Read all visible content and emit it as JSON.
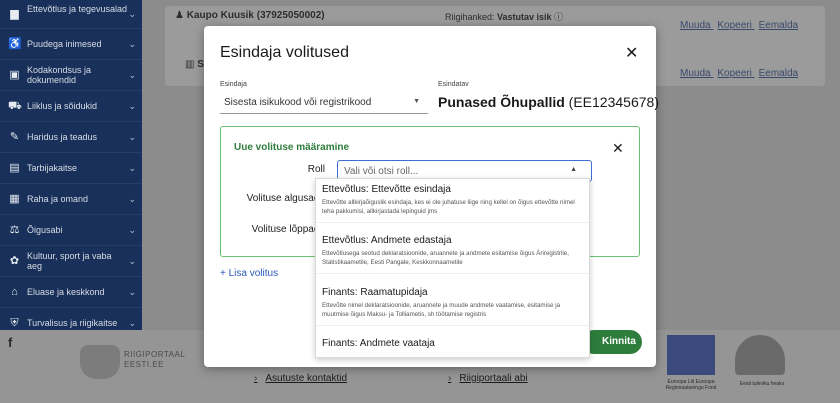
{
  "sidebar": {
    "items": [
      {
        "label": "Ettevõtlus ja tegevusalad",
        "icon": "briefcase-icon",
        "glyph": "▆"
      },
      {
        "label": "Puudega inimesed",
        "icon": "accessibility-icon",
        "glyph": "♿"
      },
      {
        "label": "Kodakondsus ja dokumendid",
        "icon": "id-card-icon",
        "glyph": "▣"
      },
      {
        "label": "Liiklus ja sõidukid",
        "icon": "car-icon",
        "glyph": "⛟"
      },
      {
        "label": "Haridus ja teadus",
        "icon": "graduation-cap-icon",
        "glyph": "✎"
      },
      {
        "label": "Tarbijakaitse",
        "icon": "cart-icon",
        "glyph": "▤"
      },
      {
        "label": "Raha ja omand",
        "icon": "money-icon",
        "glyph": "▦"
      },
      {
        "label": "Õigusabi",
        "icon": "gavel-icon",
        "glyph": "⚖"
      },
      {
        "label": "Kultuur, sport ja vaba aeg",
        "icon": "palette-icon",
        "glyph": "✿"
      },
      {
        "label": "Eluase ja keskkond",
        "icon": "home-icon",
        "glyph": "⌂"
      },
      {
        "label": "Turvalisus ja riigikaitse",
        "icon": "shield-icon",
        "glyph": "⛨"
      }
    ]
  },
  "background": {
    "row1_name": "Kaupo Kuusik (37925050002)",
    "row1_role": "Riigihanked: ",
    "row1_role_value": "Vastutav isik",
    "row1_info_icon": "ⓘ",
    "row2_prefix": "S",
    "actions": {
      "change": "Muuda",
      "copy": "Kopeeri",
      "remove": "Eemalda"
    }
  },
  "modal": {
    "title": "Esindaja volitused",
    "esindaja_label": "Esindaja",
    "esindaja_value": "Sisesta isikukood või registrikood",
    "esindatav_label": "Esindatav",
    "esindatav_name": "Punased Õhupallid",
    "esindatav_code": " (EE12345678)",
    "box_title": "Uue volituse määramine",
    "roll_label": "Roll",
    "roll_placeholder": "Vali või otsi roll...",
    "start_label": "Volituse algusaeg",
    "end_label": "Volituse lõppaeg",
    "add_label": "+ Lisa volitus",
    "confirm_label": "Kinnita"
  },
  "dropdown": {
    "options": [
      {
        "title": "Ettevõtlus: Ettevõtte esindaja",
        "desc": "Ettevõtte allkirjaõiguslik esindaja, kes ei ole juhatuse liige ning kellel on õigus ettevõtte nimel teha pakkumisi, allkirjastada lepinguid jms"
      },
      {
        "title": "Ettevõtlus: Andmete edastaja",
        "desc": "Ettevõtlusega seotud deklaratsioonide, aruannete ja andmete esitamise õigus Äriregistrile, Statistikaametile, Eesti Pangale, Keskkonnaametile"
      },
      {
        "title": "Finants: Raamatupidaja",
        "desc": "Ettevõtte nimel deklaratsioonide, aruannete ja muude andmete vaatamise, esitamise ja muutmise õigus Maksu- ja Tolliametis, sh töötamise registris"
      },
      {
        "title": "Finants: Andmete vaataja",
        "desc": ""
      }
    ]
  },
  "footer": {
    "portal_line1": "RIIGIPORTAAL",
    "portal_line2": "EESTI.EE",
    "link_contacts": "Asutuste kontaktid",
    "link_help": "Riigiportaali abi",
    "eu_text": "Euroopa Liit Euroopa Regionaalarengu Fond",
    "est_text": "Eesti tuleviku heaks"
  }
}
